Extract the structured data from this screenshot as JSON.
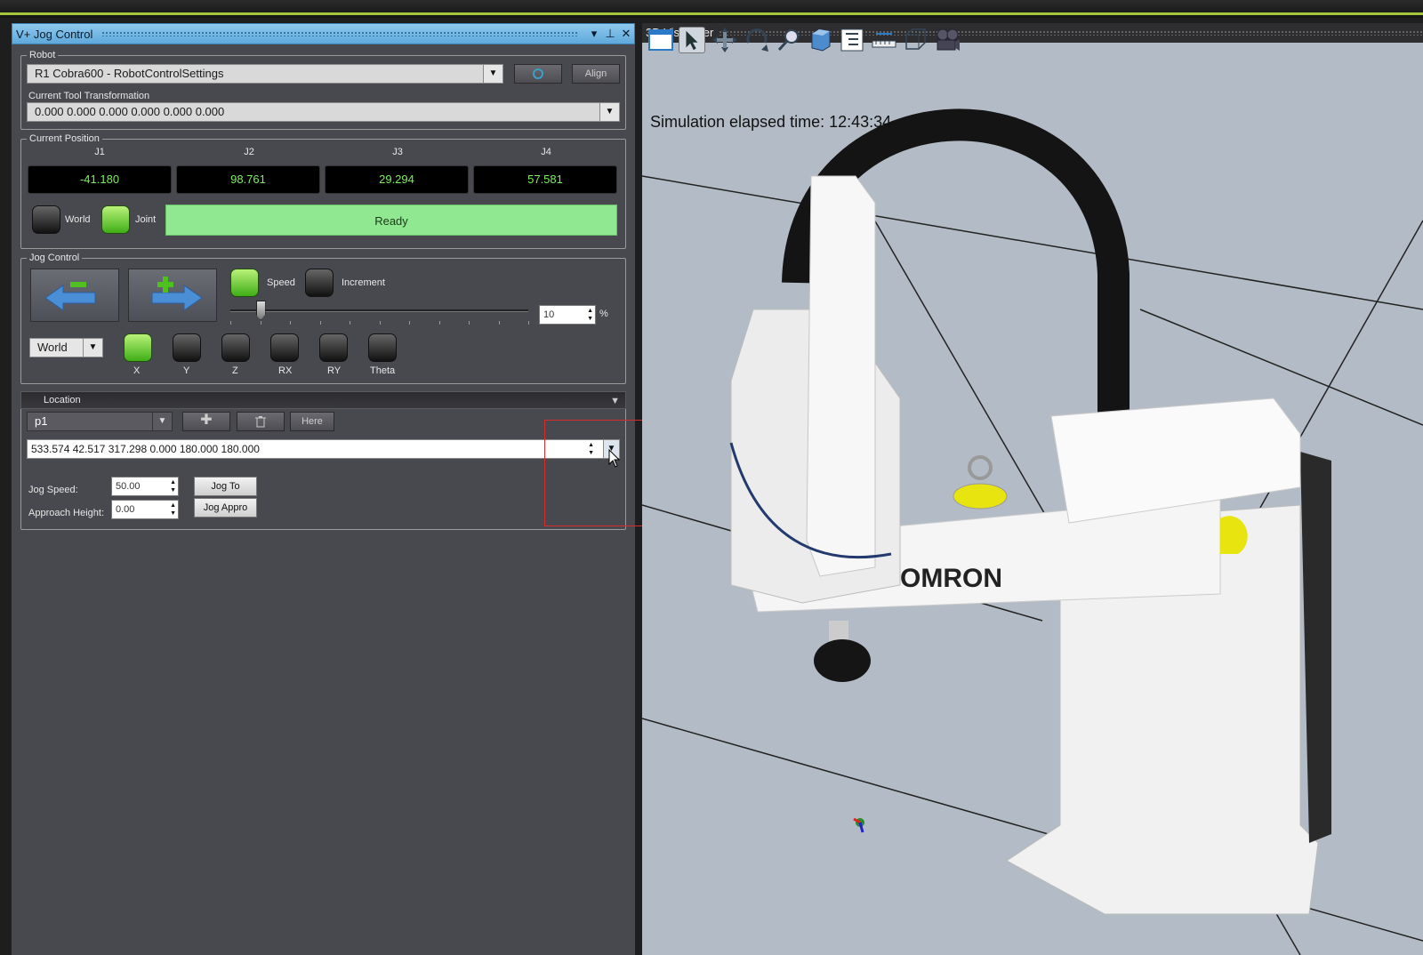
{
  "left_panel": {
    "title": "V+ Jog Control",
    "title_controls": [
      "chevron-down-icon",
      "pin-icon",
      "close-icon"
    ],
    "robot_group": {
      "legend": "Robot",
      "robot_select": "R1 Cobra600  -  RobotControlSettings",
      "align_label": "Align",
      "tool_label": "Current Tool Transformation",
      "tool_value": "0.000 0.000 0.000 0.000 0.000 0.000"
    },
    "position_group": {
      "legend": "Current Position",
      "joints": [
        {
          "label": "J1",
          "value": "-41.180"
        },
        {
          "label": "J2",
          "value": "98.761"
        },
        {
          "label": "J3",
          "value": "29.294"
        },
        {
          "label": "J4",
          "value": "57.581"
        }
      ],
      "world_label": "World",
      "joint_label": "Joint",
      "joint_mode_on": true,
      "status": "Ready",
      "status_color": "#90e890"
    },
    "jog_group": {
      "legend": "Jog Control",
      "speed_label": "Speed",
      "increment_label": "Increment",
      "speed_value": "10",
      "percent": "%",
      "frame_select": "World",
      "axes": [
        {
          "label": "X",
          "on": true
        },
        {
          "label": "Y",
          "on": false
        },
        {
          "label": "Z",
          "on": false
        },
        {
          "label": "RX",
          "on": false
        },
        {
          "label": "RY",
          "on": false
        },
        {
          "label": "Theta",
          "on": false
        }
      ]
    },
    "location_group": {
      "header": "Location",
      "location_select": "p1",
      "here_label": "Here",
      "location_value": "533.574 42.517 317.298 0.000 180.000 180.000",
      "jog_speed_label": "Jog Speed:",
      "jog_speed_value": "50.00",
      "approach_label": "Approach Height:",
      "approach_value": "0.00",
      "jog_to_label": "Jog To",
      "jog_appro_label": "Jog Appro"
    }
  },
  "right_panel": {
    "title": "3D Visualizer",
    "sim_text": "Simulation elapsed time: 12:43:34",
    "brand": "OMRON",
    "toolbar": [
      "window-icon",
      "select-arrow-icon",
      "pan-icon",
      "rotate-icon",
      "zoom-icon",
      "box-icon",
      "tree-icon",
      "measure-icon",
      "cube-wire-icon",
      "camera-icon"
    ]
  }
}
